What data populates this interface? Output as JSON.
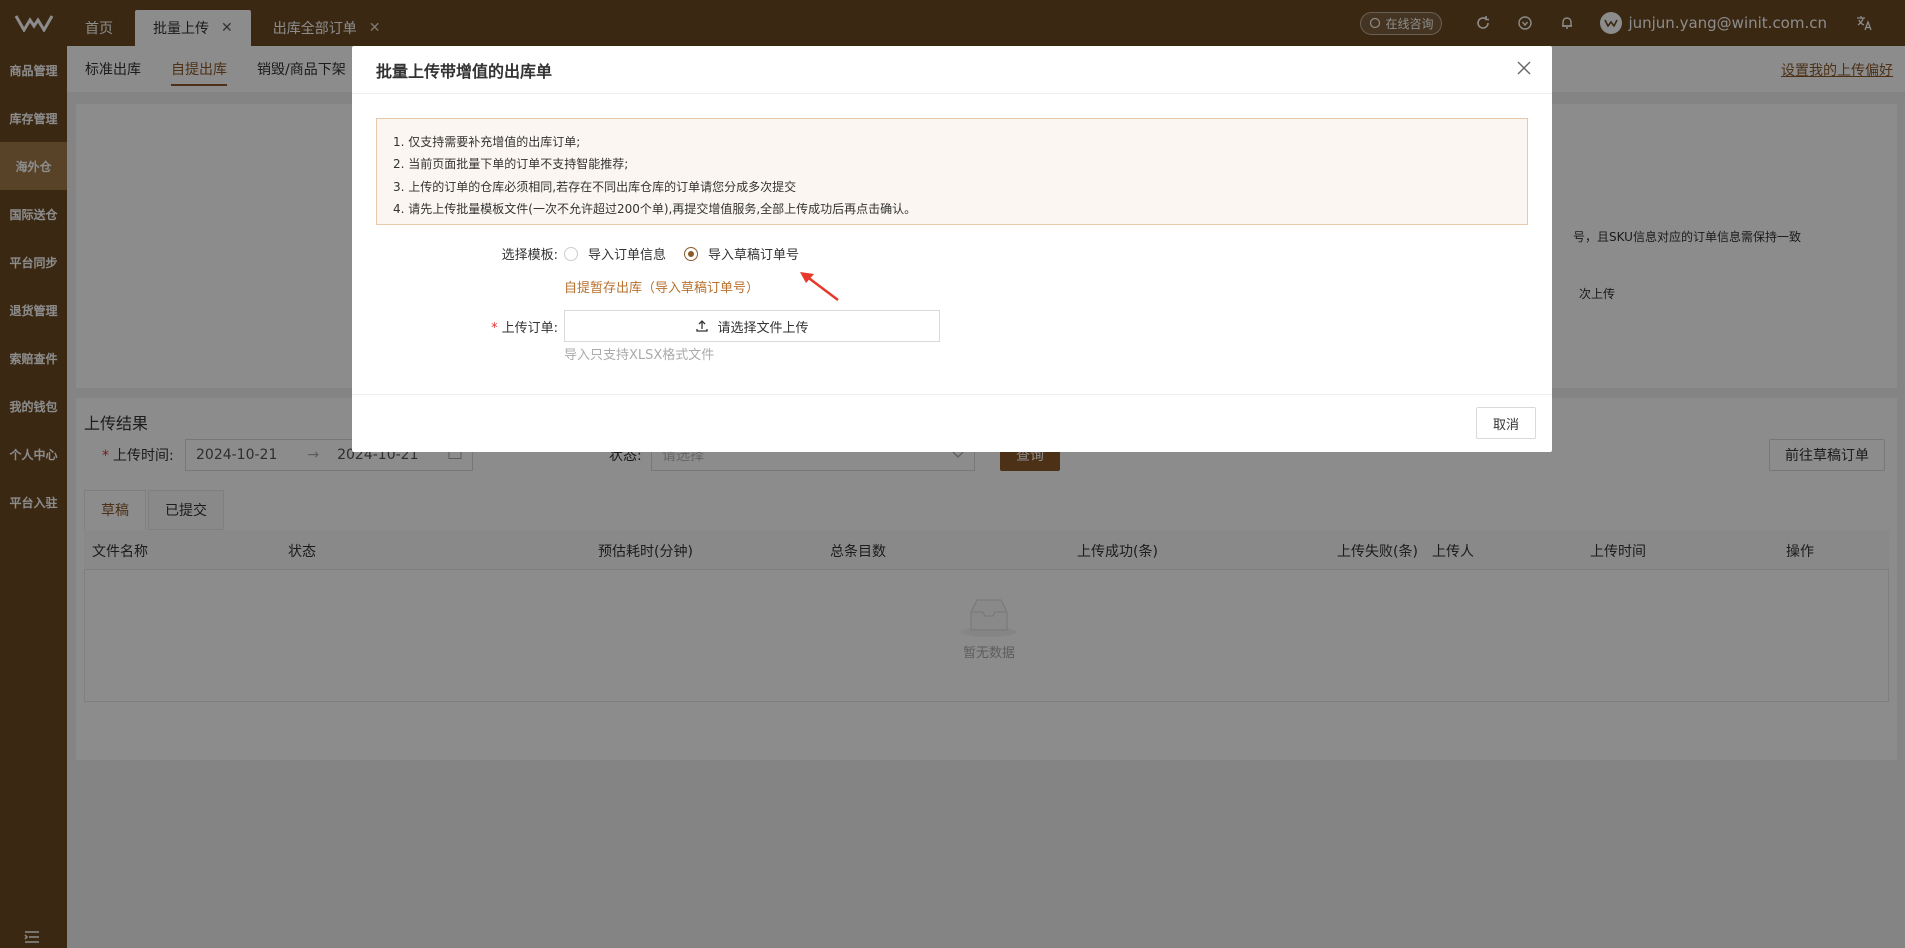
{
  "topbar": {
    "tabs": [
      {
        "label": "首页"
      },
      {
        "label": "批量上传"
      },
      {
        "label": "出库全部订单"
      }
    ],
    "consult_label": "在线咨询",
    "user_email": "junjun.yang@winit.com.cn"
  },
  "sidebar": {
    "items": [
      {
        "label": "商品管理"
      },
      {
        "label": "库存管理"
      },
      {
        "label": "海外仓"
      },
      {
        "label": "国际送仓"
      },
      {
        "label": "平台同步"
      },
      {
        "label": "退货管理"
      },
      {
        "label": "索赔查件"
      },
      {
        "label": "我的钱包"
      },
      {
        "label": "个人中心"
      },
      {
        "label": "平台入驻"
      }
    ]
  },
  "subnav": {
    "items": [
      {
        "label": "标准出库"
      },
      {
        "label": "自提出库"
      },
      {
        "label": "销毁/商品下架"
      }
    ],
    "pref_link": "设置我的上传偏好"
  },
  "background_notes": {
    "note1": "号，且SKU信息对应的订单信息需保持一致",
    "note2": "次上传"
  },
  "results": {
    "title": "上传结果",
    "upload_time_label": "上传时间:",
    "date_start": "2024-10-21",
    "date_end": "2024-10-21",
    "status_label": "状态:",
    "status_placeholder": "请选择",
    "query_label": "查询",
    "draft_link_label": "前往草稿订单",
    "tabs": [
      {
        "label": "草稿"
      },
      {
        "label": "已提交"
      }
    ],
    "columns": [
      "文件名称",
      "状态",
      "预估耗时(分钟)",
      "总条目数",
      "上传成功(条)",
      "上传失败(条)",
      "上传人",
      "上传时间",
      "操作"
    ],
    "empty_text": "暂无数据"
  },
  "modal": {
    "title": "批量上传带增值的出库单",
    "notices": [
      "1. 仅支持需要补充增值的出库订单;",
      "2. 当前页面批量下单的订单不支持智能推荐;",
      "3. 上传的订单的仓库必须相同,若存在不同出库仓库的订单请您分成多次提交",
      "4. 请先上传批量模板文件(一次不允许超过200个单),再提交增值服务,全部上传成功后再点击确认。"
    ],
    "template_label": "选择模板:",
    "radio_options": [
      {
        "label": "导入订单信息"
      },
      {
        "label": "导入草稿订单号"
      }
    ],
    "template_link": "自提暂存出库（导入草稿订单号）",
    "upload_label": "上传订单:",
    "upload_button": "请选择文件上传",
    "upload_hint": "导入只支持XLSX格式文件",
    "cancel_label": "取消"
  },
  "colors": {
    "brand": "#6b4a22",
    "accent": "#8b5a2b"
  }
}
